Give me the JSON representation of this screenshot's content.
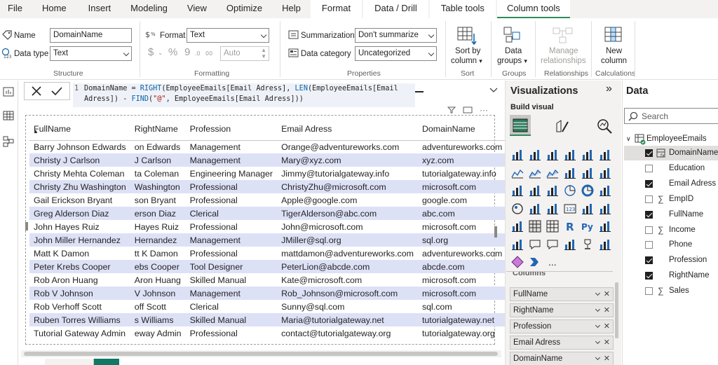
{
  "menu": {
    "items": [
      "File",
      "Home",
      "Insert",
      "Modeling",
      "View",
      "Optimize",
      "Help"
    ],
    "context_tabs": [
      "Format",
      "Data / Drill",
      "Table tools"
    ],
    "active_tab": "Column tools"
  },
  "ribbon": {
    "structure": {
      "name_label": "Name",
      "name_value": "DomainName",
      "datatype_label": "Data type",
      "datatype_value": "Text",
      "group_label": "Structure"
    },
    "formatting": {
      "format_label": "Format",
      "format_value": "Text",
      "currency": "$",
      "percent": "%",
      "comma": "9",
      "auto_value": "Auto",
      "group_label": "Formatting"
    },
    "properties": {
      "summarization_label": "Summarization",
      "summarization_value": "Don't summarize",
      "category_label": "Data category",
      "category_value": "Uncategorized",
      "group_label": "Properties"
    },
    "sort": {
      "label1": "Sort by",
      "label2": "column",
      "group_label": "Sort"
    },
    "groups": {
      "label1": "Data",
      "label2": "groups",
      "group_label": "Groups"
    },
    "relationships": {
      "label1": "Manage",
      "label2": "relationships",
      "group_label": "Relationships"
    },
    "calculations": {
      "label1": "New",
      "label2": "column",
      "group_label": "Calculations"
    }
  },
  "formula": {
    "line_number": "1",
    "line1_prefix": "DomainName = ",
    "line1_kw1": "RIGHT",
    "line1_mid": "(EmployeeEmails[Email Adress], ",
    "line1_kw2": "LEN",
    "line1_tail": "(EmployeeEmails[Email",
    "line2_head": "Adress]) - ",
    "line2_kw": "FIND",
    "line2_paren": "(",
    "line2_str": "\"@\"",
    "line2_tail": ", EmployeeEmails[Email Adress]))"
  },
  "table": {
    "headers": [
      "FullName",
      "RightName",
      "Profession",
      "Email Adress",
      "DomainName"
    ],
    "rows": [
      [
        "Barry Johnson Edwards",
        "on Edwards",
        "Management",
        "Orange@adventureworks.com",
        "adventureworks.com"
      ],
      [
        "Christy J Carlson",
        "J Carlson",
        "Management",
        "Mary@xyz.com",
        "xyz.com"
      ],
      [
        "Christy Mehta Coleman",
        "ta Coleman",
        "Engineering Manager",
        "Jimmy@tutorialgateway.info",
        "tutorialgateway.info"
      ],
      [
        "Christy Zhu Washington",
        "Washington",
        "Professional",
        "ChristyZhu@microsoft.com",
        "microsoft.com"
      ],
      [
        "Gail Erickson Bryant",
        "son Bryant",
        "Professional",
        "Apple@google.com",
        "google.com"
      ],
      [
        "Greg Alderson Diaz",
        "erson Diaz",
        "Clerical",
        "TigerAlderson@abc.com",
        "abc.com"
      ],
      [
        "John Hayes Ruiz",
        "Hayes Ruiz",
        "Professional",
        "John@microsoft.com",
        "microsoft.com"
      ],
      [
        "John Miller Hernandez",
        "Hernandez",
        "Management",
        "JMiller@sql.org",
        "sql.org"
      ],
      [
        "Matt K Damon",
        "tt K Damon",
        "Professional",
        "mattdamon@adventureworks.com",
        "adventureworks.com"
      ],
      [
        "Peter Krebs Cooper",
        "ebs Cooper",
        "Tool Designer",
        "PeterLion@abcde.com",
        "abcde.com"
      ],
      [
        "Rob Aron Huang",
        "Aron Huang",
        "Skilled Manual",
        "Kate@microsoft.com",
        "microsoft.com"
      ],
      [
        "Rob V Johnson",
        "V Johnson",
        "Management",
        "Rob_Johnson@microsoft.com",
        "microsoft.com"
      ],
      [
        "Rob Verhoff Scott",
        "off Scott",
        "Clerical",
        "Sunny@sql.com",
        "sql.com"
      ],
      [
        "Ruben Torres Williams",
        "s Williams",
        "Skilled Manual",
        "Maria@tutorialgateway.net",
        "tutorialgateway.net"
      ],
      [
        "Tutorial Gateway Admin",
        "eway Admin",
        "Professional",
        "contact@tutorialgateway.org",
        "tutorialgateway.org"
      ]
    ]
  },
  "visualizations": {
    "title": "Visualizations",
    "build_label": "Build visual",
    "more": "...",
    "wells": [
      "FullName",
      "RightName",
      "Profession",
      "Email Adress",
      "DomainName"
    ],
    "cut_label": "Columns"
  },
  "data_pane": {
    "title": "Data",
    "search_placeholder": "Search",
    "table_name": "EmployeeEmails",
    "fields": [
      {
        "name": "DomainName",
        "checked": true,
        "sigma": false
      },
      {
        "name": "Education",
        "checked": false,
        "sigma": false
      },
      {
        "name": "Email Adress",
        "checked": true,
        "sigma": false
      },
      {
        "name": "EmpID",
        "checked": false,
        "sigma": true
      },
      {
        "name": "FullName",
        "checked": true,
        "sigma": false
      },
      {
        "name": "Income",
        "checked": false,
        "sigma": true
      },
      {
        "name": "Phone",
        "checked": false,
        "sigma": false
      },
      {
        "name": "Profession",
        "checked": true,
        "sigma": false
      },
      {
        "name": "RightName",
        "checked": true,
        "sigma": false
      },
      {
        "name": "Sales",
        "checked": false,
        "sigma": true
      }
    ]
  },
  "colors": {
    "accent": "#2d8b5a",
    "row_alt": "#dde1f6",
    "keyword": "#0b63a8",
    "string": "#a31515"
  }
}
